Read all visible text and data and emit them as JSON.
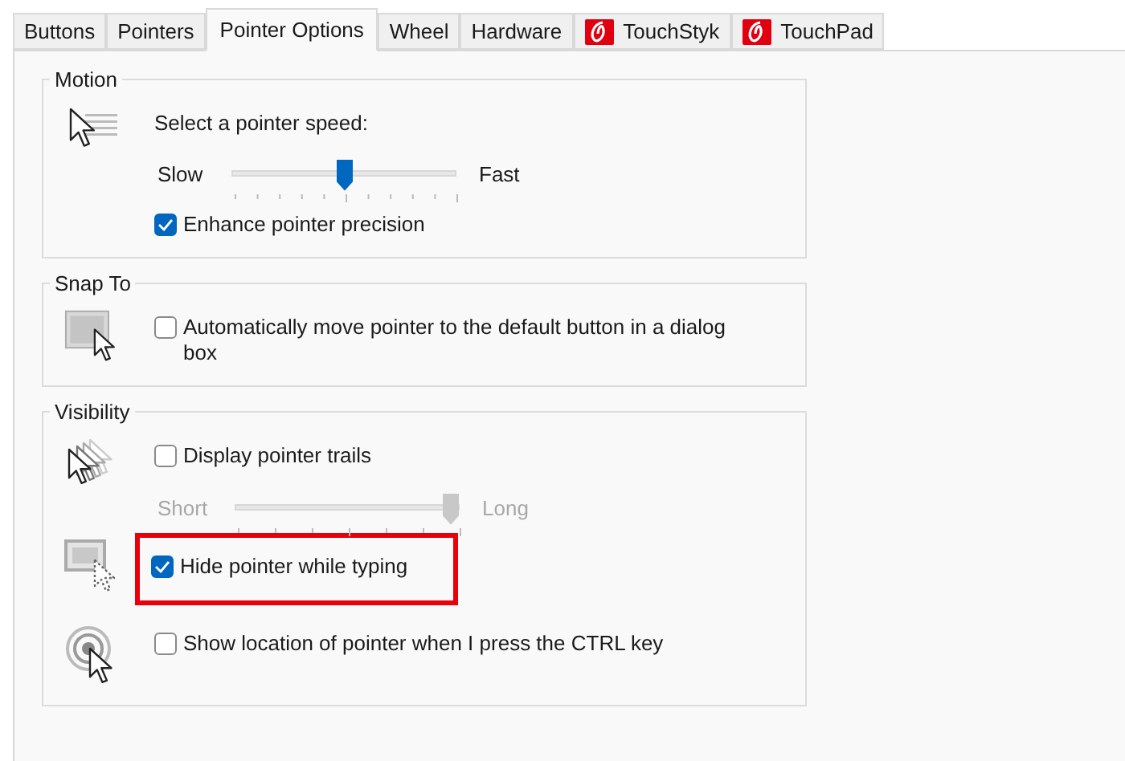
{
  "tabs": [
    {
      "label": "Buttons",
      "selected": false,
      "kind": "plain"
    },
    {
      "label": "Pointers",
      "selected": false,
      "kind": "plain"
    },
    {
      "label": "Pointer Options",
      "selected": true,
      "kind": "plain"
    },
    {
      "label": "Wheel",
      "selected": false,
      "kind": "plain"
    },
    {
      "label": "Hardware",
      "selected": false,
      "kind": "plain"
    },
    {
      "label": "TouchStyk",
      "selected": false,
      "kind": "logo"
    },
    {
      "label": "TouchPad",
      "selected": false,
      "kind": "logo"
    }
  ],
  "groups": [
    {
      "title": "Motion",
      "rows": [
        {
          "kind": "speed",
          "label": "Select a pointer speed:",
          "slider": {
            "min_label": "Slow",
            "max_label": "Fast",
            "level": 0.5,
            "disabled": false
          },
          "checkbox": {
            "label": "Enhance pointer precision",
            "checked": true
          }
        }
      ]
    },
    {
      "title": "Snap To",
      "rows": [
        {
          "kind": "snap",
          "checkbox": {
            "label": "Automatically move pointer to the default button in a dialog box",
            "checked": false
          }
        }
      ]
    },
    {
      "title": "Visibility",
      "rows": [
        {
          "kind": "trails",
          "checkbox": {
            "label": "Display pointer trails",
            "checked": false
          },
          "slider": {
            "min_label": "Short",
            "max_label": "Long",
            "level": 1,
            "disabled": true
          }
        },
        {
          "kind": "hide",
          "checkbox": {
            "label": "Hide pointer while typing",
            "checked": true
          },
          "highlighted": true
        },
        {
          "kind": "locate",
          "checkbox": {
            "label": "Show location of pointer when I press the CTRL key",
            "checked": false
          }
        }
      ]
    }
  ]
}
